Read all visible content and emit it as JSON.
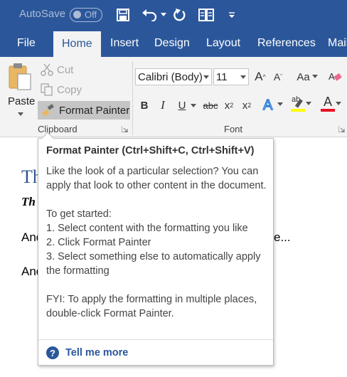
{
  "titlebar": {
    "autosave_label": "AutoSave",
    "autosave_state": "Off",
    "icons": [
      "save-icon",
      "undo-icon",
      "undo-dropdown-icon",
      "redo-icon",
      "touch-mode-icon",
      "customize-qat-icon"
    ]
  },
  "tabs": [
    {
      "label": "File"
    },
    {
      "label": "Home",
      "active": true
    },
    {
      "label": "Insert"
    },
    {
      "label": "Design"
    },
    {
      "label": "Layout"
    },
    {
      "label": "References"
    },
    {
      "label": "Mail"
    }
  ],
  "clipboard": {
    "paste_label": "Paste",
    "cut_label": "Cut",
    "copy_label": "Copy",
    "format_painter_label": "Format Painter",
    "group_label": "Clipboard"
  },
  "font": {
    "font_name": "Calibri (Body)",
    "font_size": "11",
    "bold": "B",
    "italic": "I",
    "underline": "U",
    "strikethrough": "abc",
    "subscript": "x",
    "subscript_mark": "2",
    "superscript": "x",
    "superscript_mark": "2",
    "change_case": "Aa",
    "grow_font": "A",
    "shrink_font": "A",
    "highlight_label": "ab",
    "font_color_label": "A",
    "group_label": "Font"
  },
  "document": {
    "title": "Th",
    "subtitle": "Th",
    "line1_start": "And",
    "line1_end": "e...",
    "line2_start": "And"
  },
  "tooltip": {
    "title": "Format Painter (Ctrl+Shift+C, Ctrl+Shift+V)",
    "paragraph1": "Like the look of a particular selection? You can apply that look to other content in the document.",
    "get_started": "To get started:",
    "step1": "1. Select content with the formatting you like",
    "step2": "2. Click Format Painter",
    "step3": "3. Select something else to automatically apply the formatting",
    "fyi": "FYI: To apply the formatting in multiple places, double-click Format Painter.",
    "tell_me_more": "Tell me more"
  },
  "colors": {
    "brand": "#2b579a",
    "ribbon_bg": "#f3f3f3",
    "highlight_yellow": "#ffff00",
    "font_red": "#e81123",
    "doc_heading": "#2e5395"
  }
}
